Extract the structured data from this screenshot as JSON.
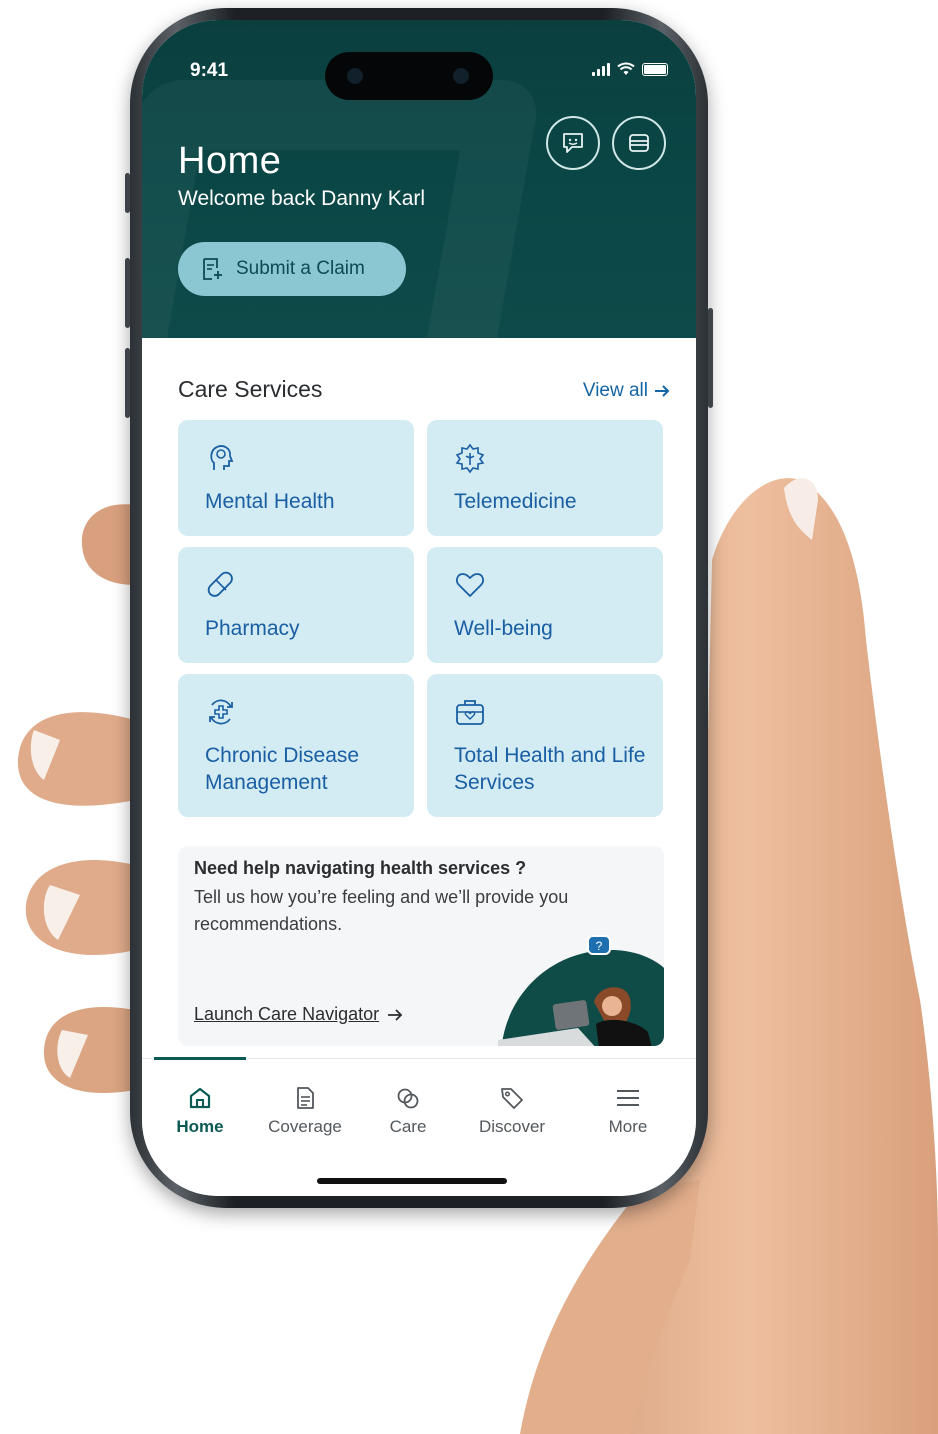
{
  "status_bar": {
    "time": "9:41"
  },
  "header": {
    "title": "Home",
    "welcome": "Welcome back Danny Karl",
    "claim_button": "Submit a Claim",
    "chat_icon": "chat-bubble-icon",
    "card_icon": "wallet-card-icon"
  },
  "care_services": {
    "title": "Care Services",
    "view_all": "View all",
    "tiles": [
      {
        "label": "Mental Health",
        "icon": "mental-health-icon"
      },
      {
        "label": "Telemedicine",
        "icon": "telemedicine-icon"
      },
      {
        "label": "Pharmacy",
        "icon": "pill-icon"
      },
      {
        "label": "Well-being",
        "icon": "heart-icon"
      },
      {
        "label": "Chronic Disease Management",
        "icon": "chronic-disease-icon"
      },
      {
        "label": "Total Health and Life Services",
        "icon": "medical-kit-icon"
      }
    ]
  },
  "help_card": {
    "title": "Need help navigating health services ?",
    "body": "Tell us how you’re feeling and we’ll provide you recommendations.",
    "link": "Launch Care Navigator"
  },
  "nav": {
    "items": [
      {
        "label": "Home",
        "icon": "home-icon",
        "active": true
      },
      {
        "label": "Coverage",
        "icon": "document-icon",
        "active": false
      },
      {
        "label": "Care",
        "icon": "care-icon",
        "active": false
      },
      {
        "label": "Discover",
        "icon": "tag-icon",
        "active": false
      },
      {
        "label": "More",
        "icon": "menu-icon",
        "active": false
      }
    ]
  },
  "colors": {
    "header_bg": "#0a4746",
    "claim_button_bg": "#8bc7d3",
    "tile_bg": "#d3ebf2",
    "tile_text": "#1a5fa3",
    "link_blue": "#1565a4",
    "nav_active": "#0d5a55"
  }
}
